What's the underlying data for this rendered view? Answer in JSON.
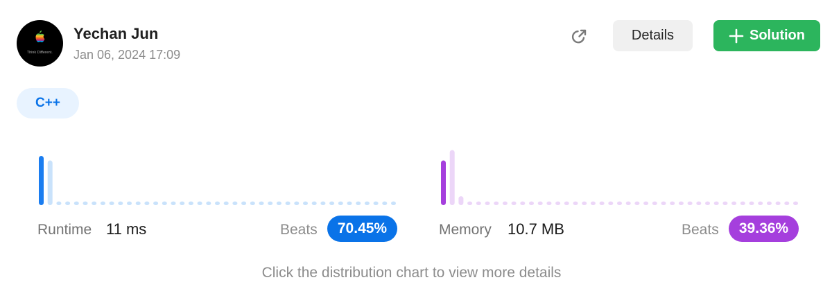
{
  "user": {
    "name": "Yechan Jun",
    "timestamp": "Jan 06, 2024 17:09",
    "avatar_caption": "Think Different."
  },
  "header": {
    "details_label": "Details",
    "solution_label": "Solution"
  },
  "language": "C++",
  "runtime": {
    "label": "Runtime",
    "value": "11 ms",
    "beats_label": "Beats",
    "beats_pct": "70.45%",
    "color": "#0a73e8"
  },
  "memory": {
    "label": "Memory",
    "value": "10.7 MB",
    "beats_label": "Beats",
    "beats_pct": "39.36%",
    "color": "#a53fdd"
  },
  "hint": "Click the distribution chart to view more details",
  "chart_data": [
    {
      "type": "bar",
      "name": "runtime-distribution",
      "values": [
        66,
        60,
        5,
        5,
        5,
        5,
        5,
        5,
        5,
        5,
        5,
        5,
        5,
        5,
        5,
        5,
        5,
        5,
        5,
        5,
        5,
        5,
        5,
        5,
        5,
        5,
        5,
        5,
        5,
        5,
        5,
        5,
        5,
        5,
        5,
        5,
        5,
        5,
        5,
        5,
        5
      ],
      "highlight_index": 0,
      "highlight_color": "#1a7df0",
      "bar_color": "#c9e2fb"
    },
    {
      "type": "bar",
      "name": "memory-distribution",
      "values": [
        60,
        74,
        12,
        5,
        5,
        5,
        5,
        5,
        5,
        5,
        5,
        5,
        5,
        5,
        5,
        5,
        5,
        5,
        5,
        5,
        5,
        5,
        5,
        5,
        5,
        5,
        5,
        5,
        5,
        5,
        5,
        5,
        5,
        5,
        5,
        5,
        5,
        5,
        5,
        5,
        5
      ],
      "highlight_index": 0,
      "highlight_color": "#a53fdd",
      "bar_color": "#ecd6f8"
    }
  ]
}
